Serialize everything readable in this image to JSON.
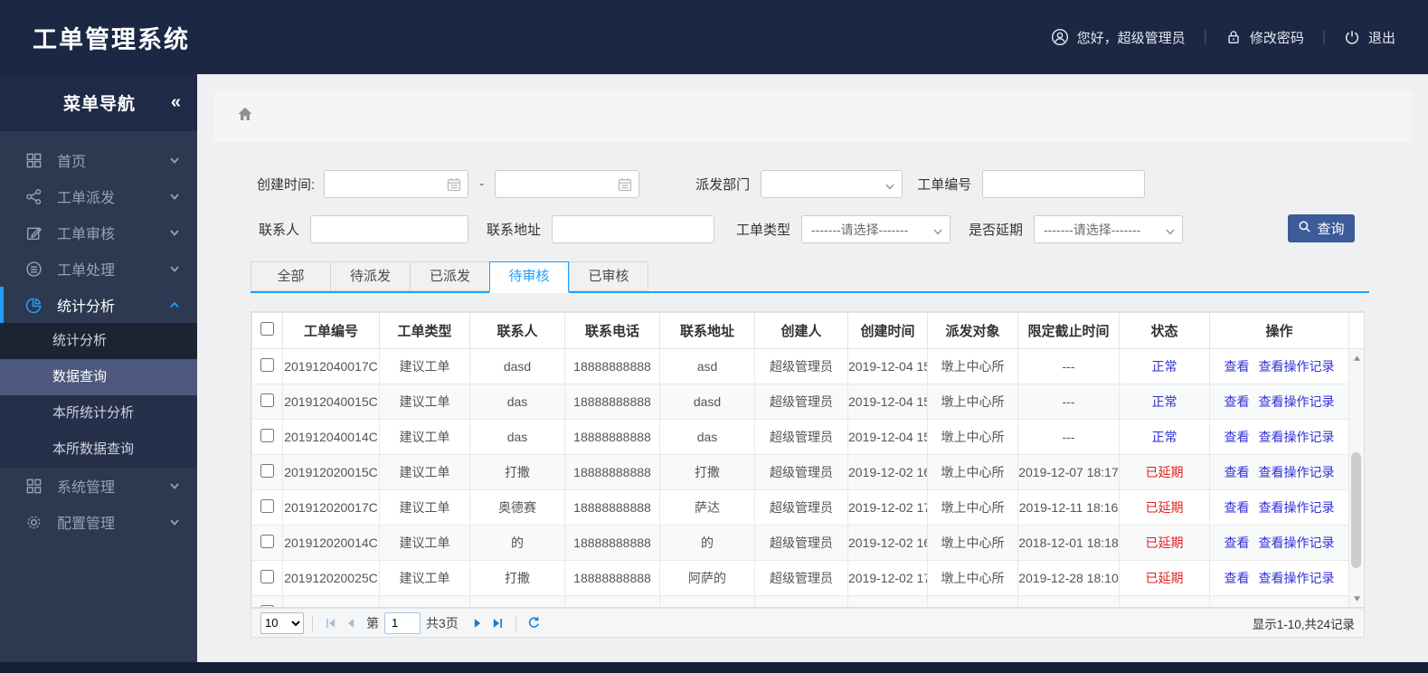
{
  "header": {
    "title": "工单管理系统",
    "greeting": "您好，超级管理员",
    "change_password": "修改密码",
    "logout": "退出",
    "separator": "|"
  },
  "sidebar": {
    "nav_title": "菜单导航",
    "collapse_glyph": "«",
    "items": [
      {
        "label": "首页",
        "icon": "grid-icon",
        "chevron": "down"
      },
      {
        "label": "工单派发",
        "icon": "share-icon",
        "chevron": "down"
      },
      {
        "label": "工单审核",
        "icon": "edit-icon",
        "chevron": "down"
      },
      {
        "label": "工单处理",
        "icon": "process-icon",
        "chevron": "down"
      },
      {
        "label": "统计分析",
        "icon": "pie-icon",
        "chevron": "up",
        "active": true,
        "children": [
          {
            "label": "统计分析",
            "dark": true
          },
          {
            "label": "数据查询",
            "selected": true
          },
          {
            "label": "本所统计分析"
          },
          {
            "label": "本所数据查询"
          }
        ]
      },
      {
        "label": "系统管理",
        "icon": "modules-icon",
        "chevron": "down"
      },
      {
        "label": "配置管理",
        "icon": "gear-icon",
        "chevron": "down"
      }
    ]
  },
  "filters": {
    "create_time_label": "创建时间:",
    "range_separator": "-",
    "dispatch_dept_label": "派发部门",
    "order_no_label": "工单编号",
    "contact_label": "联系人",
    "address_label": "联系地址",
    "order_type_label": "工单类型",
    "delay_label": "是否延期",
    "select_placeholder": "-------请选择-------",
    "search_button": "查询"
  },
  "tabs": [
    {
      "label": "全部"
    },
    {
      "label": "待派发"
    },
    {
      "label": "已派发"
    },
    {
      "label": "待审核",
      "active": true
    },
    {
      "label": "已审核"
    }
  ],
  "table": {
    "columns": [
      "工单编号",
      "工单类型",
      "联系人",
      "联系电话",
      "联系地址",
      "创建人",
      "创建时间",
      "派发对象",
      "限定截止时间",
      "状态",
      "操作"
    ],
    "action_labels": [
      "查看",
      "查看操作记录"
    ],
    "rows": [
      {
        "order_no": "201912040017C",
        "order_type": "建议工单",
        "contact": "dasd",
        "phone": "18888888888",
        "address": "asd",
        "creator": "超级管理员",
        "create_time": "2019-12-04 15:",
        "dispatch_target": "墩上中心所",
        "deadline": "---",
        "status": "正常",
        "delayed": false
      },
      {
        "order_no": "201912040015C",
        "order_type": "建议工单",
        "contact": "das",
        "phone": "18888888888",
        "address": "dasd",
        "creator": "超级管理员",
        "create_time": "2019-12-04 15:",
        "dispatch_target": "墩上中心所",
        "deadline": "---",
        "status": "正常",
        "delayed": false
      },
      {
        "order_no": "201912040014C",
        "order_type": "建议工单",
        "contact": "das",
        "phone": "18888888888",
        "address": "das",
        "creator": "超级管理员",
        "create_time": "2019-12-04 15:",
        "dispatch_target": "墩上中心所",
        "deadline": "---",
        "status": "正常",
        "delayed": false
      },
      {
        "order_no": "201912020015C",
        "order_type": "建议工单",
        "contact": "打撒",
        "phone": "18888888888",
        "address": "打撒",
        "creator": "超级管理员",
        "create_time": "2019-12-02 16:",
        "dispatch_target": "墩上中心所",
        "deadline": "2019-12-07 18:17",
        "status": "已延期",
        "delayed": true
      },
      {
        "order_no": "201912020017C",
        "order_type": "建议工单",
        "contact": "奥德赛",
        "phone": "18888888888",
        "address": "萨达",
        "creator": "超级管理员",
        "create_time": "2019-12-02 17:",
        "dispatch_target": "墩上中心所",
        "deadline": "2019-12-11 18:16",
        "status": "已延期",
        "delayed": true
      },
      {
        "order_no": "201912020014C",
        "order_type": "建议工单",
        "contact": "的",
        "phone": "18888888888",
        "address": "的",
        "creator": "超级管理员",
        "create_time": "2019-12-02 16:",
        "dispatch_target": "墩上中心所",
        "deadline": "2018-12-01 18:18",
        "status": "已延期",
        "delayed": true
      },
      {
        "order_no": "201912020025C",
        "order_type": "建议工单",
        "contact": "打撒",
        "phone": "18888888888",
        "address": "阿萨的",
        "creator": "超级管理员",
        "create_time": "2019-12-02 17:",
        "dispatch_target": "墩上中心所",
        "deadline": "2019-12-28 18:10",
        "status": "已延期",
        "delayed": true
      }
    ],
    "partial_row_visible": true
  },
  "pagination": {
    "page_size_options": [
      "10"
    ],
    "page_size": "10",
    "page_prefix": "第",
    "current_page": "1",
    "total_pages": "共3页",
    "summary": "显示1-10,共24记录"
  },
  "colors": {
    "header_bg": "#1b2743",
    "sidebar_bg": "#2d3950",
    "accent_blue": "#1e9fff",
    "submenu_selected": "#4d587c",
    "search_button_bg": "#3d5b99",
    "link_blue": "#3232d8",
    "status_normal": "#2d2dd0",
    "status_delayed": "#e01f1f"
  }
}
